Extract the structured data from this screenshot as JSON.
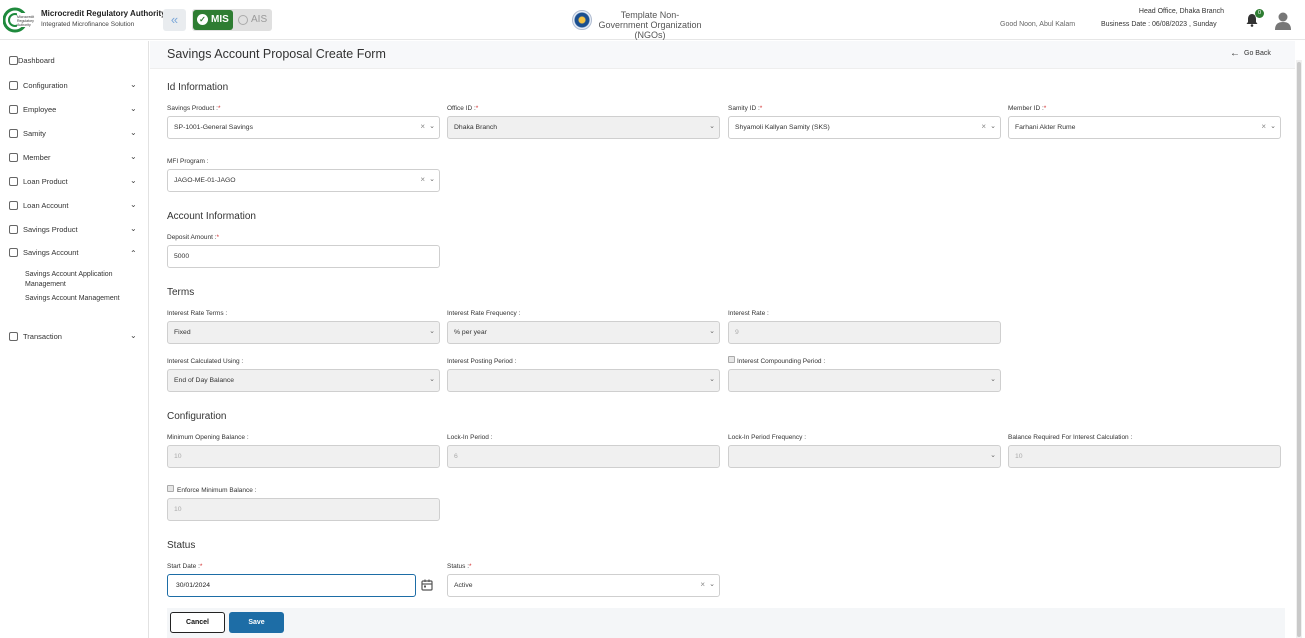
{
  "header": {
    "org_name": "Microcredit Regulatory Authority",
    "org_subtitle": "Integrated Microfinance Solution",
    "toggle_mis": "MIS",
    "toggle_ais": "AIS",
    "ngo_name": "Template Non-Government Organization (NGOs)",
    "greeting": "Good Noon, Abul Kalam",
    "branch": "Head Office, Dhaka Branch",
    "business_date": "Business Date : 06/08/2023 , Sunday",
    "notification_count": "0"
  },
  "sidebar": {
    "items": [
      {
        "label": "Dashboard"
      },
      {
        "label": "Configuration"
      },
      {
        "label": "Employee"
      },
      {
        "label": "Samity"
      },
      {
        "label": "Member"
      },
      {
        "label": "Loan Product"
      },
      {
        "label": "Loan Account"
      },
      {
        "label": "Savings Product"
      },
      {
        "label": "Savings Account"
      },
      {
        "label": "Transaction"
      }
    ],
    "sub_items": [
      {
        "label": "Savings Account Application Management"
      },
      {
        "label": "Savings Account Management"
      }
    ]
  },
  "page": {
    "title": "Savings Account Proposal Create Form",
    "go_back": "Go Back"
  },
  "sections": {
    "id_info": "Id Information",
    "account_info": "Account Information",
    "terms": "Terms",
    "configuration": "Configuration",
    "status": "Status"
  },
  "fields": {
    "savings_product": {
      "label": "Savings Product :",
      "value": "SP-1001-General Savings"
    },
    "office_id": {
      "label": "Office ID :",
      "value": "Dhaka Branch"
    },
    "samity_id": {
      "label": "Samity ID :",
      "value": "Shyamoli Kallyan Samity (SKS)"
    },
    "member_id": {
      "label": "Member ID :",
      "value": "Farhani Akter Rume"
    },
    "mfi_program": {
      "label": "MFI Program :",
      "value": "JAGO-ME-01-JAGO"
    },
    "deposit_amount": {
      "label": "Deposit Amount :",
      "value": "5000"
    },
    "interest_rate_terms": {
      "label": "Interest Rate Terms :",
      "value": "Fixed"
    },
    "interest_rate_frequency": {
      "label": "Interest Rate Frequency :",
      "value": "% per year"
    },
    "interest_rate": {
      "label": "Interest Rate :",
      "value": "9"
    },
    "interest_calculated_using": {
      "label": "Interest Calculated Using :",
      "value": "End of Day Balance"
    },
    "interest_posting_period": {
      "label": "Interest Posting Period :",
      "value": ""
    },
    "interest_compounding_period": {
      "label": "Interest Compounding Period :",
      "value": ""
    },
    "minimum_opening_balance": {
      "label": "Minimum Opening Balance :",
      "value": "10"
    },
    "lock_in_period": {
      "label": "Lock-In Period :",
      "value": "6"
    },
    "lock_in_period_frequency": {
      "label": "Lock-In Period Frequency :",
      "value": ""
    },
    "balance_required": {
      "label": "Balance Required For Interest Calculation :",
      "value": "10"
    },
    "enforce_minimum_balance": {
      "label": "Enforce Minimum Balance :",
      "value": "10"
    },
    "start_date": {
      "label": "Start Date :",
      "value": "30/01/2024"
    },
    "status": {
      "label": "Status :",
      "value": "Active"
    }
  },
  "required_marker": "*",
  "buttons": {
    "cancel": "Cancel",
    "save": "Save"
  }
}
